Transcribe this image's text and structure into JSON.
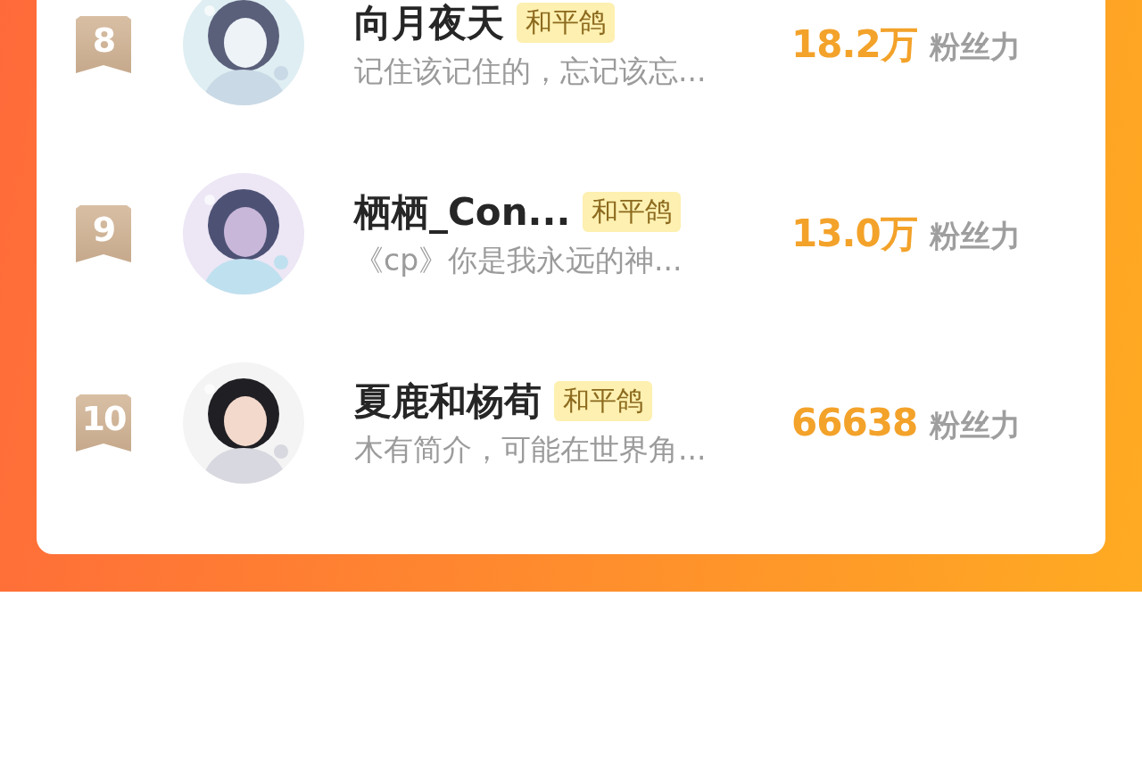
{
  "ranking": [
    {
      "rank": "8",
      "name": "向月夜天",
      "tag": "和平鸽",
      "bio": "记住该记住的，忘记该忘...",
      "score": "18.2万",
      "score_unit": "粉丝力"
    },
    {
      "rank": "9",
      "name": "栖栖_Con...",
      "tag": "和平鸽",
      "bio": "《cp》你是我永远的神...",
      "score": "13.0万",
      "score_unit": "粉丝力"
    },
    {
      "rank": "10",
      "name": "夏鹿和杨荀",
      "tag": "和平鸽",
      "bio": "木有简介，可能在世界角...",
      "score": "66638",
      "score_unit": "粉丝力"
    }
  ]
}
